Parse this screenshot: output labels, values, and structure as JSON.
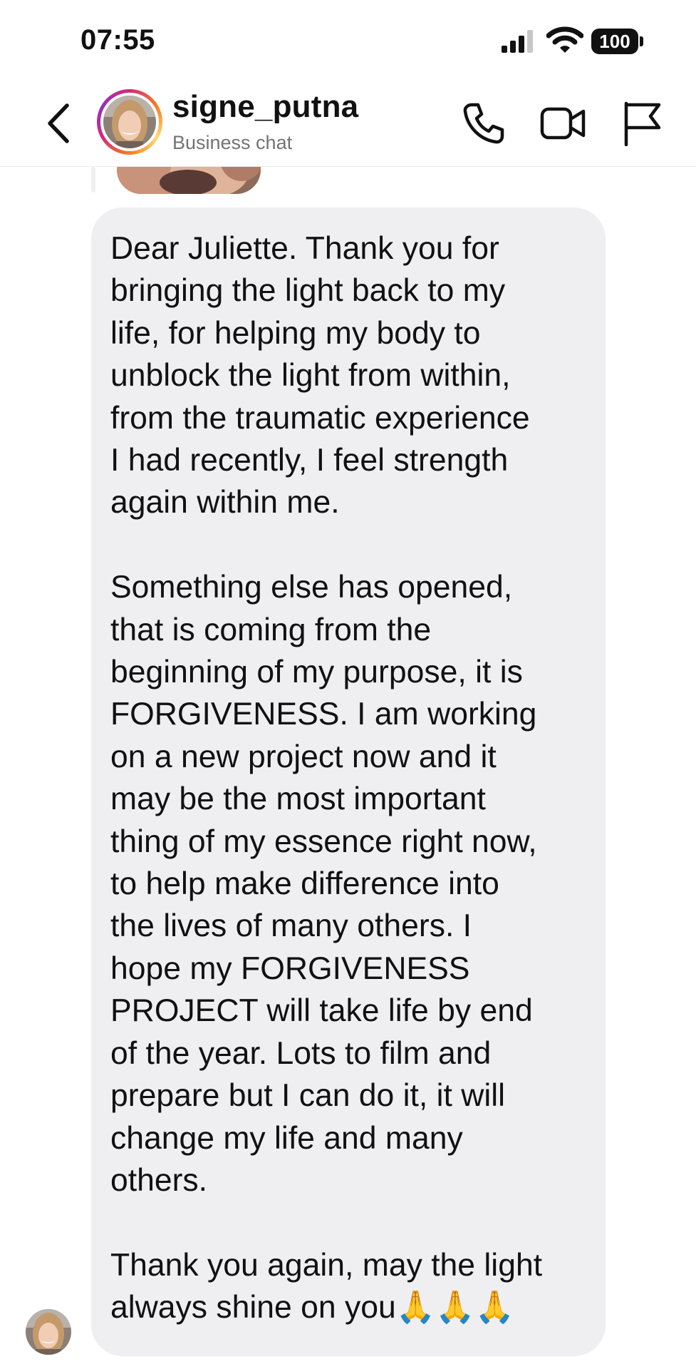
{
  "status_bar": {
    "time": "07:55",
    "battery": "100",
    "icons": [
      "signal-icon",
      "wifi-icon",
      "battery-icon"
    ]
  },
  "header": {
    "contact_name": "signe_putna",
    "subtitle": "Business chat",
    "icons": [
      "back-chevron-icon",
      "phone-icon",
      "video-camera-icon",
      "flag-icon"
    ]
  },
  "colors": {
    "bubble": "#efeff2",
    "text": "#111111",
    "subtitle": "#737373",
    "story_ring": [
      "#d62976",
      "#fa7e1e",
      "#feda75",
      "#962fbf"
    ]
  },
  "message": {
    "lines": [
      "Dear Juliette. Thank you for",
      "bringing the light back to my",
      "life, for helping my body to",
      "unblock the light from within,",
      "from the traumatic experience",
      "I had recently, I feel strength",
      "again within me.",
      "",
      "Something else has opened,",
      "that is coming from the",
      "beginning of my purpose, it is",
      "FORGIVENESS. I am working",
      "on a new project now and it",
      "may be the most important",
      "thing of my essence right now,",
      "to help make difference into",
      "the lives of many others. I",
      "hope my FORGIVENESS",
      "PROJECT will take life by end",
      "of the year. Lots to film and",
      "prepare but I can do it, it will",
      "change my life and many",
      "others.",
      "",
      "Thank you again, may the light",
      "always shine on you🙏🙏🙏"
    ]
  }
}
